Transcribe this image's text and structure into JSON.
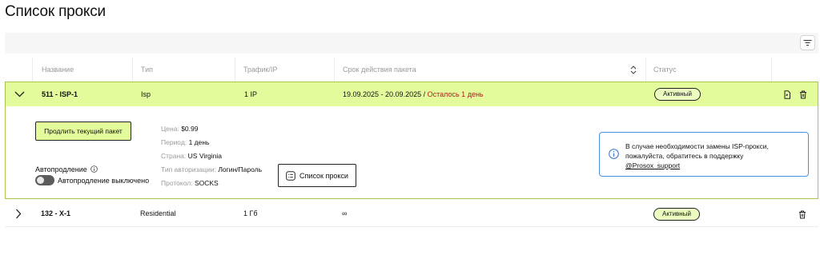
{
  "page_title": "Список прокси",
  "table": {
    "headers": {
      "name": "Название",
      "type": "Тип",
      "traffic": "Трафик/IP",
      "period": "Срок действия пакета",
      "status": "Статус"
    },
    "rows": [
      {
        "name": "511 - ISP-1",
        "type": "Isp",
        "traffic": "1 IP",
        "period_dates": "19.09.2025 - 20.09.2025",
        "period_sep": " / ",
        "period_remaining": "Осталось 1 день",
        "status": "Активный"
      },
      {
        "name": "132 - X-1",
        "type": "Residential",
        "traffic": "1 Гб",
        "period_dates": "∞",
        "status": "Активный"
      }
    ]
  },
  "details": {
    "extend_button": "Продлить текущий пакет",
    "price_label": "Цена:",
    "price_value": "$0.99",
    "period_label": "Период:",
    "period_value": "1 день",
    "country_label": "Страна:",
    "country_value": "US Virginia",
    "auth_label": "Тип авторизации:",
    "auth_value": "Логин/Пароль",
    "protocol_label": "Протокол:",
    "protocol_value": "SOCKS",
    "proxy_list_button": "Список прокси",
    "autorenew_label": "Автопродление",
    "autorenew_state": "Автопродление выключено",
    "notice_text": "В случае необходимости замены ISP-прокси, пожалуйста, обратитесь в поддержку",
    "notice_link": "@Prosox_support"
  }
}
